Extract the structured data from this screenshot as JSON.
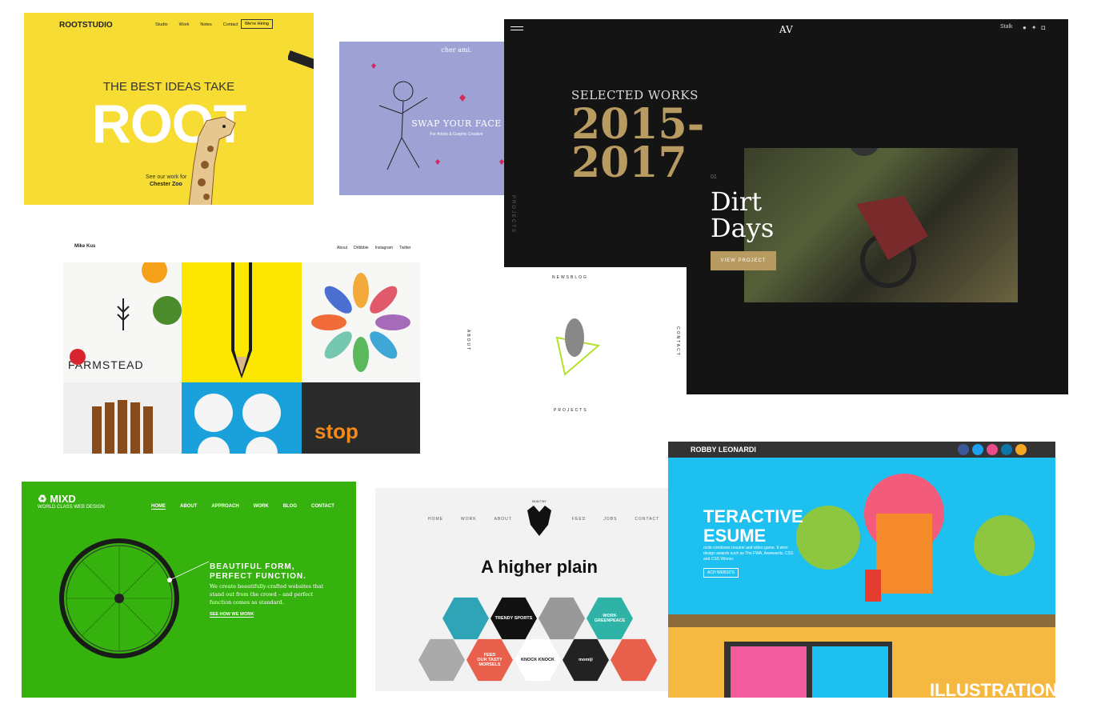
{
  "root": {
    "logo": "ROOTSTUDIO",
    "nav": [
      "Studio",
      "Work",
      "Notes",
      "Contact"
    ],
    "hiring": "We're Hiring",
    "line1": "THE BEST IDEAS TAKE",
    "line2": "ROOT",
    "caption1": "See our work for",
    "caption2": "Chester Zoo"
  },
  "cheraml": {
    "logo": "cher ami.",
    "headline": "SWAP YOUR FACE",
    "sub": "For Artists & Graphic Creative"
  },
  "dark": {
    "monogram": "AV",
    "stalk": "Stalk",
    "selected": "SELECTED WORKS",
    "years": "2015-\n2017",
    "num": "01",
    "title_line1": "Dirt",
    "title_line2": "Days",
    "button": "VIEW PROJECT",
    "side": "PROJECTS"
  },
  "mike": {
    "name": "Mike Kus",
    "nav": [
      "About",
      "Dribbble",
      "Instagram",
      "Twitter"
    ],
    "farmstead": "FARMSTEAD"
  },
  "news": {
    "top": "NEWSBLOG",
    "left": "ABOUT",
    "right": "CONTACT",
    "bottom": "PROJECTS"
  },
  "mixd": {
    "logo": "MIXD",
    "sub": "WORLD CLASS WEB DESIGN",
    "nav": [
      "HOME",
      "ABOUT",
      "APPROACH",
      "WORK",
      "BLOG",
      "CONTACT"
    ],
    "h1": "BEAUTIFUL FORM,",
    "h2": "PERFECT FUNCTION.",
    "body": "We create beautifully-crafted websites that stand out from the crowd – and perfect function comes as standard.",
    "cta": "SEE HOW WE WORK"
  },
  "higher": {
    "built": "BUILT BY",
    "nav_left": [
      "HOME",
      "WORK",
      "ABOUT"
    ],
    "nav_right": [
      "FEED",
      "JOBS",
      "CONTACT"
    ],
    "headline": "A higher plain",
    "hexes": [
      "TRENDY SPORTS",
      "WORK",
      "GREENPEACE",
      "FEED",
      "OUR TASTY MORSELS",
      "KNOCK KNOCK",
      "momiji"
    ]
  },
  "robby": {
    "name": "ROBBY LEONARDI",
    "h1": "TERACTIVE",
    "h2": "ESUME",
    "body": "ocde combines resume and video game. It wins design awards such as The FWA, Awwwards, CSS and CSS Winner.",
    "btn": "ACH WEBSITE",
    "illustration": "ILLUSTRATION"
  }
}
